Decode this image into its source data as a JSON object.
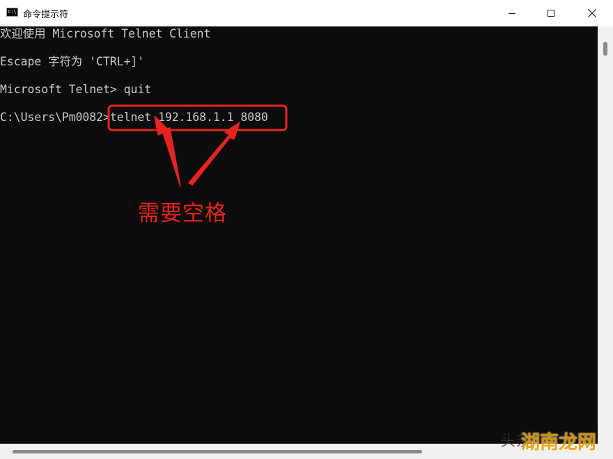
{
  "window": {
    "title": "命令提示符",
    "app_icon_text": "C:\\"
  },
  "console": {
    "lines": [
      "欢迎使用 Microsoft Telnet Client",
      "Escape 字符为 'CTRL+]'",
      "Microsoft Telnet> quit",
      "C:\\Users\\Pm0082>telnet 192.168.1.1 8080"
    ],
    "text_color": "#cccccc",
    "background": "#0c0c0c"
  },
  "annotation": {
    "label": "需要空格",
    "color": "#e8231f"
  },
  "watermark": {
    "text_a": "头条",
    "text_b": "湖南龙网",
    "color": "#e8a000"
  }
}
